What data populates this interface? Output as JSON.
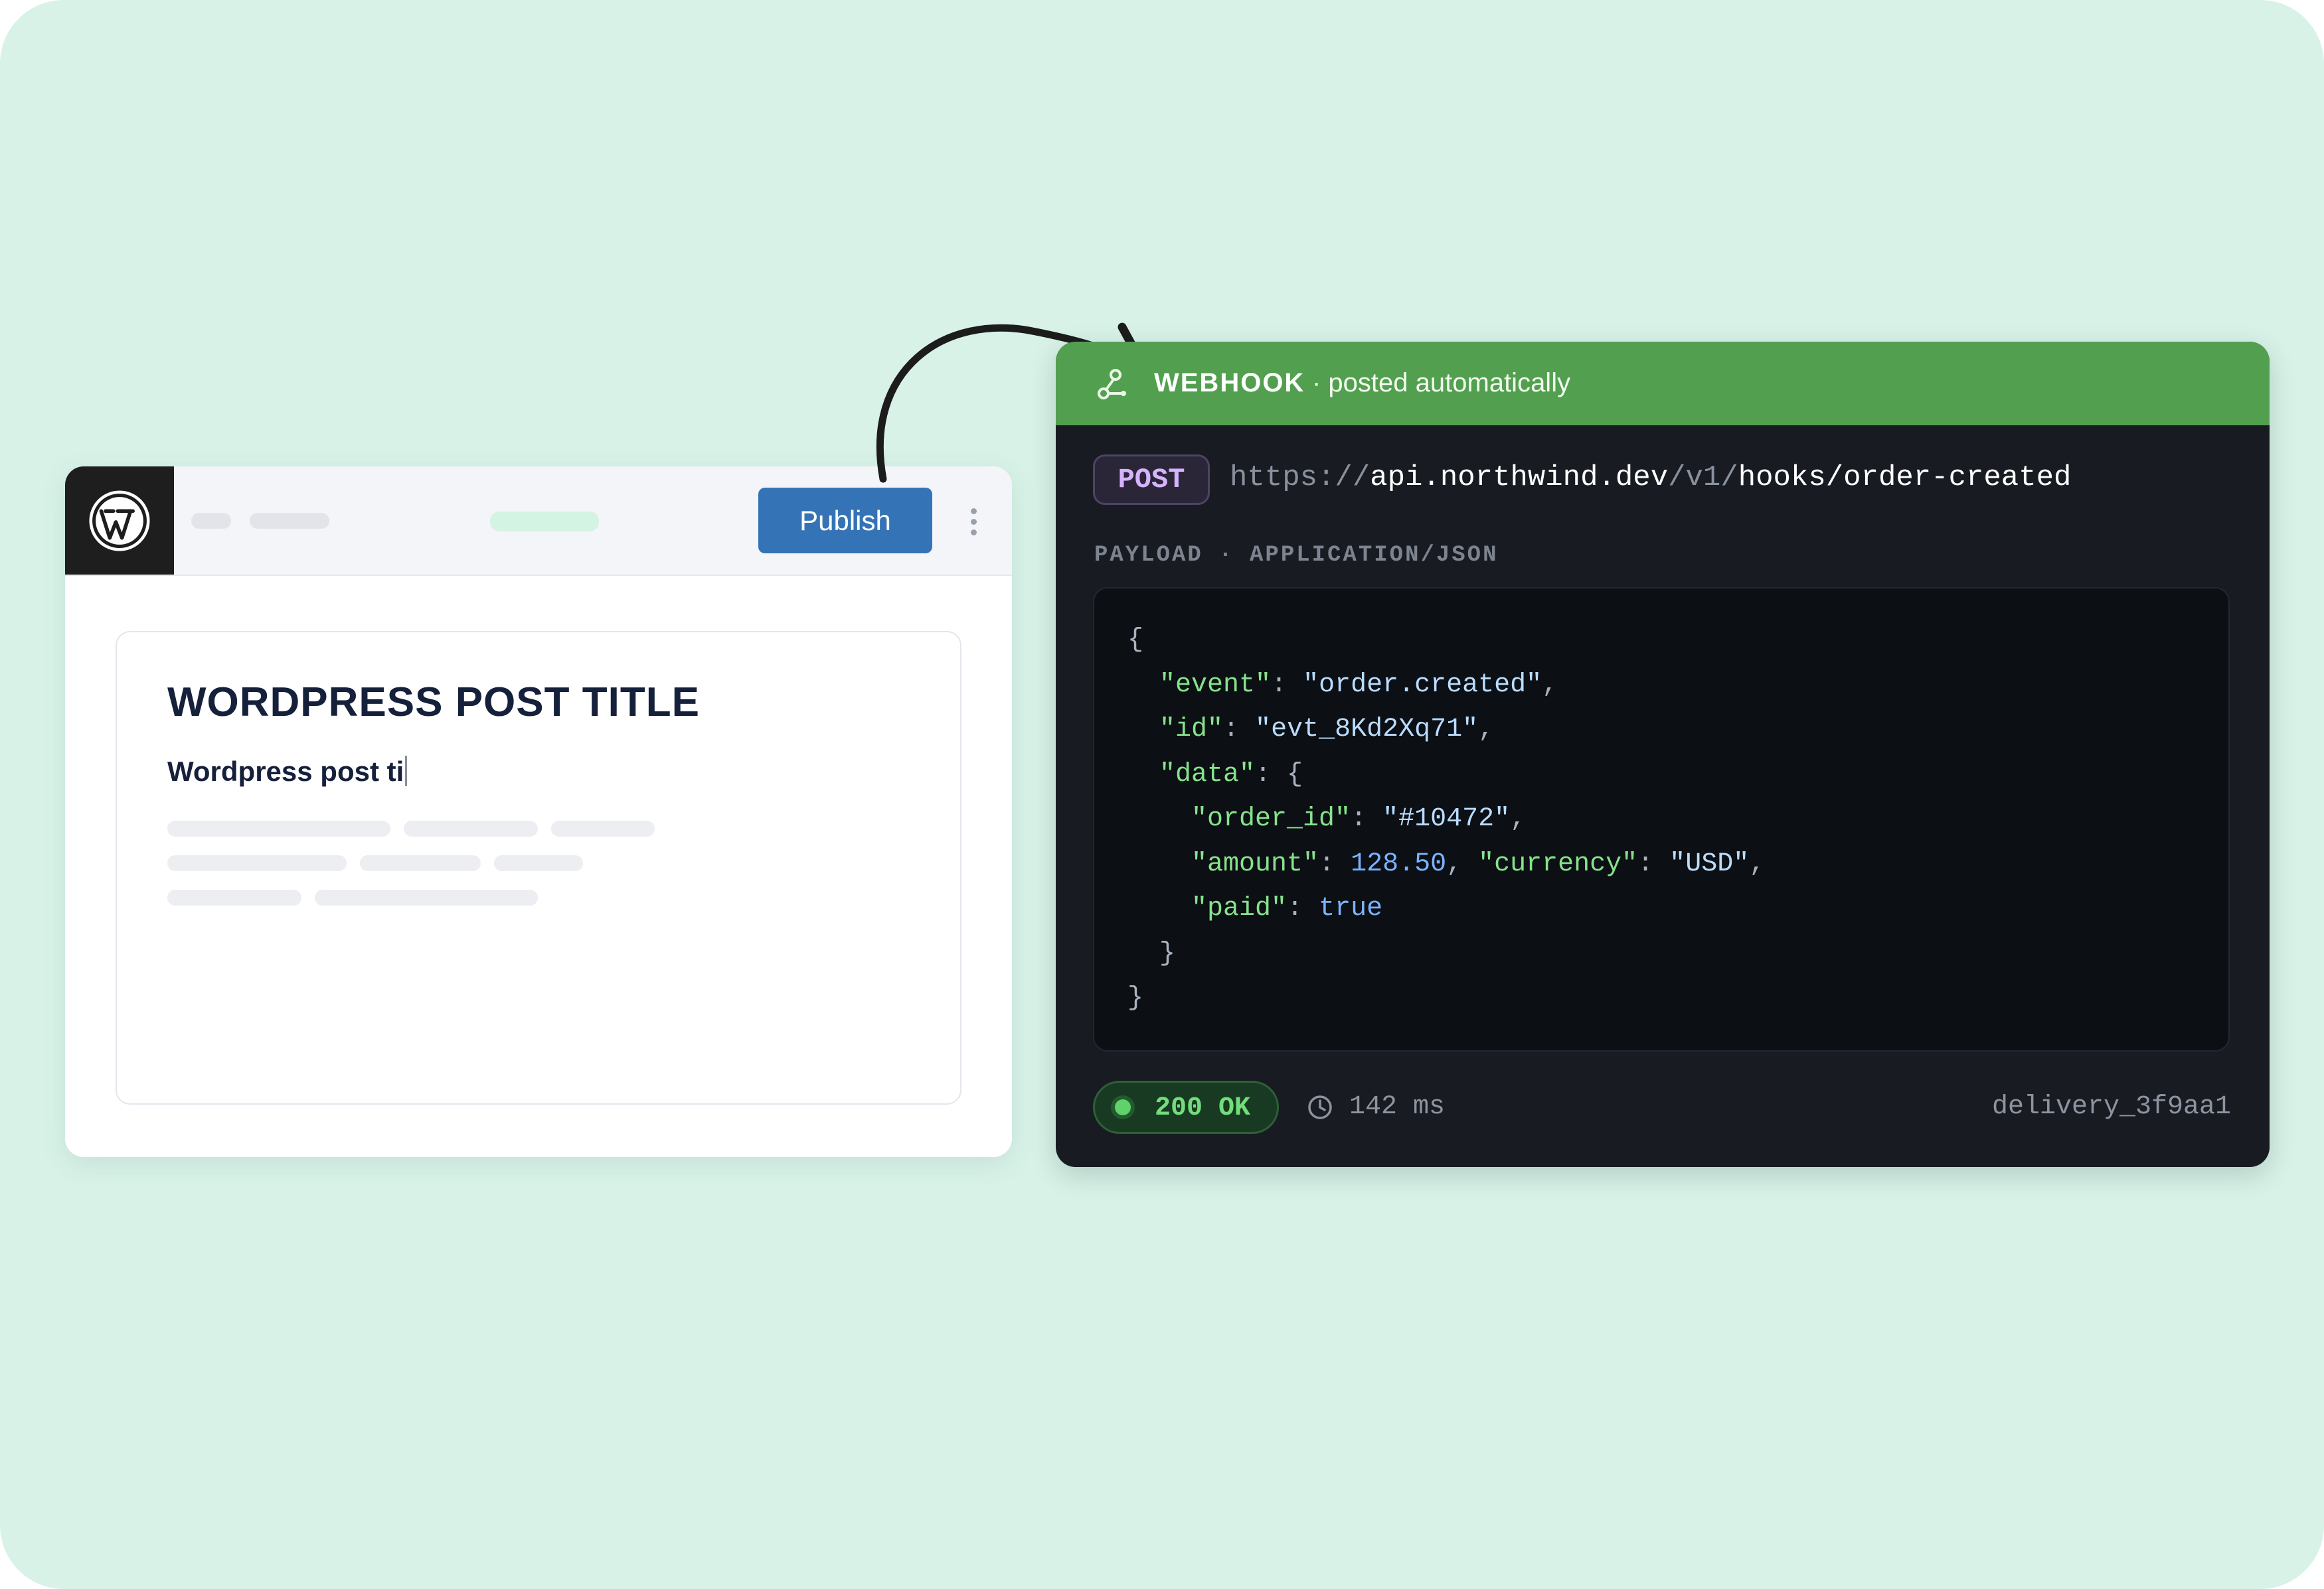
{
  "wordpress": {
    "publish_label": "Publish",
    "post_title": "WORDPRESS POST TITLE",
    "post_subtitle_typing": "Wordpress post ti"
  },
  "webhook": {
    "label": "WEBHOOK",
    "subtitle": "· posted automatically",
    "method": "POST",
    "url": {
      "scheme": "https://",
      "host": "api.northwind.dev",
      "version": "/v1/",
      "path": "hooks/order-created"
    },
    "payload_label": "PAYLOAD · APPLICATION/JSON",
    "payload": {
      "event": "order.created",
      "id": "evt_8Kd2Xq71",
      "order_id": "#10472",
      "amount": "128.50",
      "currency": "USD",
      "paid": "true"
    },
    "status": "200 OK",
    "duration": "142 ms",
    "delivery_id": "delivery_3f9aa1"
  },
  "colors": {
    "background": "#d8f2e8",
    "publish_button": "#3474b6",
    "webhook_header": "#52a04f",
    "webhook_body": "#181c22",
    "status_ok": "#73dd7c",
    "method_badge": "#d6b3ff"
  },
  "icons": {
    "wordpress_logo": "wordpress-logo-icon",
    "webhook": "webhook-icon",
    "clock": "clock-icon",
    "more": "kebab-menu-icon",
    "arrow": "curved-arrow-icon"
  }
}
